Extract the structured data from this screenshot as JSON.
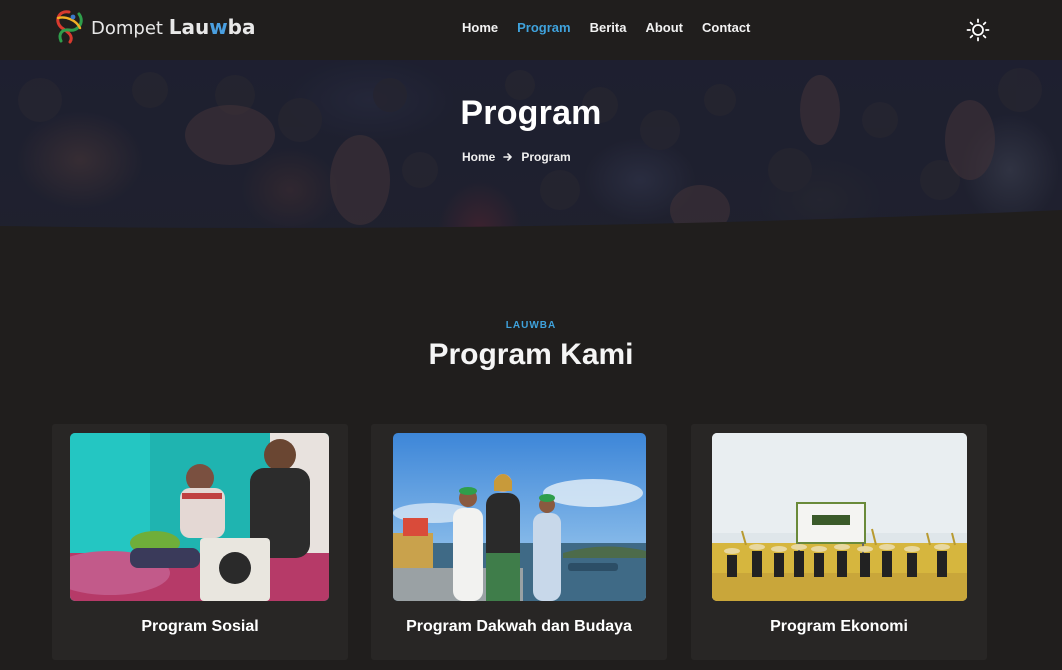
{
  "header": {
    "brand": {
      "first": "Dompet",
      "second_a": "Lau",
      "second_b": "w",
      "second_c": "ba"
    },
    "nav": [
      {
        "label": "Home",
        "active": false
      },
      {
        "label": "Program",
        "active": true
      },
      {
        "label": "Berita",
        "active": false
      },
      {
        "label": "About",
        "active": false
      },
      {
        "label": "Contact",
        "active": false
      }
    ],
    "theme_icon": "sun-icon"
  },
  "hero": {
    "title": "Program",
    "breadcrumb": {
      "home": "Home",
      "separator_icon": "arrow-right-icon",
      "current": "Program"
    }
  },
  "section": {
    "eyebrow": "LAUWBA",
    "title": "Program Kami"
  },
  "cards": [
    {
      "title": "Program Sosial"
    },
    {
      "title": "Program Dakwah dan Budaya"
    },
    {
      "title": "Program Ekonomi"
    }
  ],
  "colors": {
    "background": "#201e1d",
    "card": "#282625",
    "accent": "#3fa2dc",
    "text": "#ffffff"
  }
}
